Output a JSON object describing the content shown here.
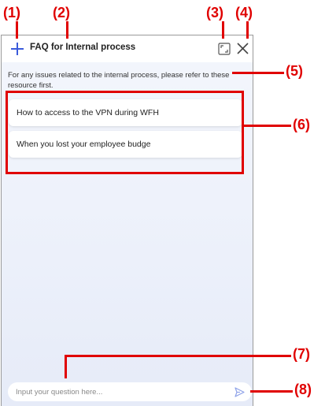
{
  "panel": {
    "title": "FAQ for Internal process",
    "intro": "For any issues related to the internal process, please refer to these resource first.",
    "faq_items": [
      {
        "label": "How to access to the VPN during WFH"
      },
      {
        "label": "When you lost your employee budge"
      }
    ],
    "input": {
      "placeholder": "Input your question here...",
      "value": ""
    }
  },
  "icons": {
    "new": "plus-icon",
    "expand": "expand-icon",
    "close": "close-icon",
    "send": "send-icon"
  },
  "colors": {
    "accent": "#3b5bdb",
    "annotation": "#e00000",
    "panel_bg": "#eef2fb"
  },
  "annotations": {
    "c1": "(1)",
    "c2": "(2)",
    "c3": "(3)",
    "c4": "(4)",
    "c5": "(5)",
    "c6": "(6)",
    "c7": "(7)",
    "c8": "(8)"
  }
}
